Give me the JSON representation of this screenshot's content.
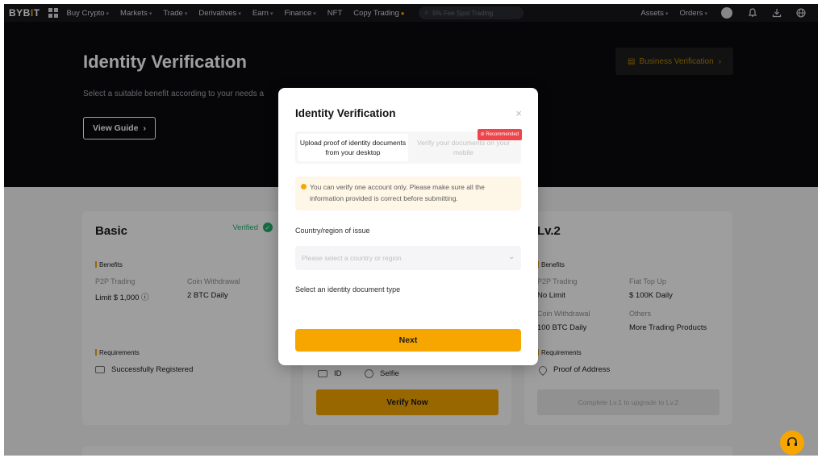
{
  "nav": {
    "logo": "BYBIT",
    "items": [
      "Buy Crypto",
      "Markets",
      "Trade",
      "Derivatives",
      "Earn",
      "Finance",
      "NFT",
      "Copy Trading"
    ],
    "search_placeholder": "5% Fee Spot Trading",
    "right_items": [
      "Assets",
      "Orders"
    ],
    "icons": [
      "grid-icon",
      "search-icon",
      "avatar",
      "bell-icon",
      "download-icon",
      "globe-icon"
    ]
  },
  "hero": {
    "title": "Identity Verification",
    "subtitle": "Select a suitable benefit according to your needs a",
    "guide_button": "View Guide",
    "business_button": "Business Verification"
  },
  "cards": {
    "basic": {
      "title": "Basic",
      "status": "Verified",
      "benefits_label": "Benefits",
      "benefit_1_key": "P2P Trading",
      "benefit_1_value": "Limit $ 1,000",
      "benefit_2_key": "Coin Withdrawal",
      "benefit_2_value": "2 BTC Daily",
      "requirements_label": "Requirements",
      "requirement": "Successfully Registered"
    },
    "mid": {
      "req_1": "ID",
      "req_2": "Selfie",
      "button": "Verify Now"
    },
    "lv2": {
      "title": "Lv.2",
      "benefits_label": "Benefits",
      "b1_key": "P2P Trading",
      "b1_value": "No Limit",
      "b2_key": "Fiat Top Up",
      "b2_value": "$ 100K Daily",
      "b3_key": "Coin Withdrawal",
      "b3_value": "100 BTC Daily",
      "b4_key": "Others",
      "b4_value": "More Trading Products",
      "requirements_label": "Requirements",
      "requirement": "Proof of Address",
      "button": "Complete Lv.1 to upgrade to Lv.2"
    }
  },
  "modal": {
    "title": "Identity Verification",
    "close": "×",
    "tab_1": "Upload proof of identity documents from your desktop",
    "tab_2": "Verify your documents on your mobile",
    "recommended_badge": "Recommended",
    "notice": "You can verify one account only. Please make sure all the information provided is correct before submitting.",
    "country_label": "Country/region of issue",
    "country_placeholder": "Please select a country or region",
    "doc_type_label": "Select an identity document type",
    "next_button": "Next"
  },
  "colors": {
    "accent": "#f7a600",
    "success": "#20b26c",
    "danger": "#ef454a"
  }
}
